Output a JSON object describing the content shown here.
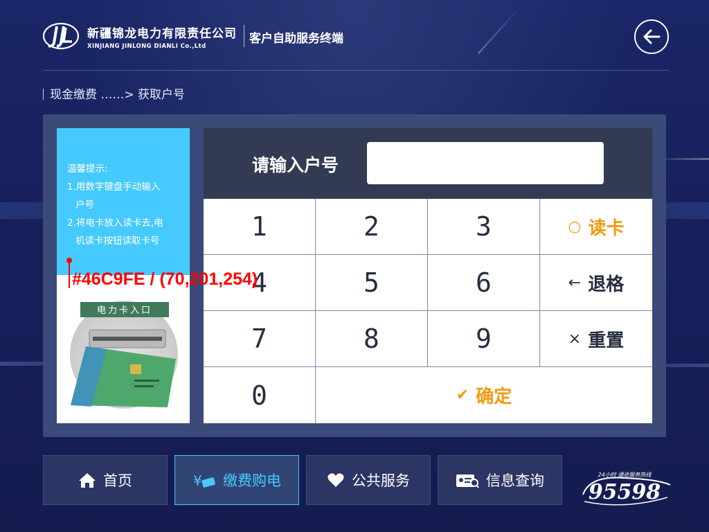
{
  "header": {
    "company_cn": "新疆锦龙电力有限责任公司",
    "company_en": "XINJIANG JINLONG DIANLI Co.,Ltd",
    "terminal": "客户自助服务终端"
  },
  "breadcrumb": {
    "text": "现金缴费 ……> 获取户号"
  },
  "tips": {
    "title": "温馨提示:",
    "tip1_a": "1.用数字键盘手动输入",
    "tip1_b": "户号",
    "tip2_a": "2.将电卡放入读卡去,电",
    "tip2_b": "机读卡按钮读取卡号",
    "card_slot": "电力卡入口"
  },
  "overlay": {
    "text": "#46C9FE / (70,201,254)"
  },
  "keypad": {
    "label": "请输入户号",
    "input_value": "",
    "keys": {
      "k1": "1",
      "k2": "2",
      "k3": "3",
      "k4": "4",
      "k5": "5",
      "k6": "6",
      "k7": "7",
      "k8": "8",
      "k9": "9",
      "k0": "0"
    },
    "read_card": "读卡",
    "backspace": "退格",
    "reset": "重置",
    "confirm": "确定"
  },
  "nav": {
    "home": "首页",
    "pay": "缴费购电",
    "public": "公共服务",
    "info": "信息查询"
  },
  "hotline": {
    "number": "95598",
    "slogan": "24小时 通途服务热线"
  },
  "colors": {
    "accent": "#46C9FE",
    "orange": "#F39A10",
    "panel": "#3B4A78",
    "keypad_header": "#333A53"
  }
}
